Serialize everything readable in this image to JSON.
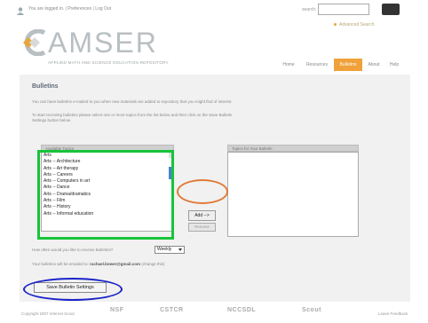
{
  "topbar": {
    "user_text": "You are logged in. | Preferences | Log Out",
    "search_label": "search:",
    "search_value": "",
    "advanced_search": "Advanced Search"
  },
  "logo": {
    "word": "AMSER",
    "tagline": "APPLIED MATH AND SCIENCE EDUCATION REPOSITORY"
  },
  "nav": {
    "items": [
      {
        "label": "Home"
      },
      {
        "label": "Resources"
      },
      {
        "label": "Bulletins"
      },
      {
        "label": "About"
      },
      {
        "label": "Help"
      }
    ],
    "active": "Bulletins"
  },
  "main": {
    "title": "Bulletins",
    "intro": "You can have bulletins e-mailed to you when new materials are added to repository that you might find of interest.",
    "instructions_1": "To start receiving bulletins please select one or more topics from the list below and then click on the Save Bulletin",
    "instructions_2": "Settings button below.",
    "available_header": "Available Topics",
    "your_header": "Topics for Your Bulletin",
    "topics": [
      "Arts",
      "Arts -- Architecture",
      "Arts -- Art therapy",
      "Arts -- Careers",
      "Arts -- Computers in art",
      "Arts -- Dance",
      "Arts -- Drama/dramatics",
      "Arts -- Film",
      "Arts -- History",
      "Arts -- Informal education"
    ],
    "add_label": "Add -->",
    "remove_label": "Remove",
    "freq_label": "How often would you like to receive Bulletins?",
    "freq_value": "Weekly",
    "email_prefix": "Your bulletins will be emailed to:",
    "email": "rachael.bower@gmail.com",
    "email_change": "(change this)",
    "save_label": "Save Bulletin Settings"
  },
  "footer": {
    "copyright": "Copyright 2007 Internet Scout",
    "feedback": "Leave Feedback",
    "partners": [
      "NSF",
      "CSTCR",
      "NCCSDL",
      "Scout"
    ]
  },
  "colors": {
    "accent": "#f0a13a",
    "annotation_green": "#17c43a",
    "annotation_orange": "#e07a38",
    "annotation_blue": "#1a23c8"
  }
}
